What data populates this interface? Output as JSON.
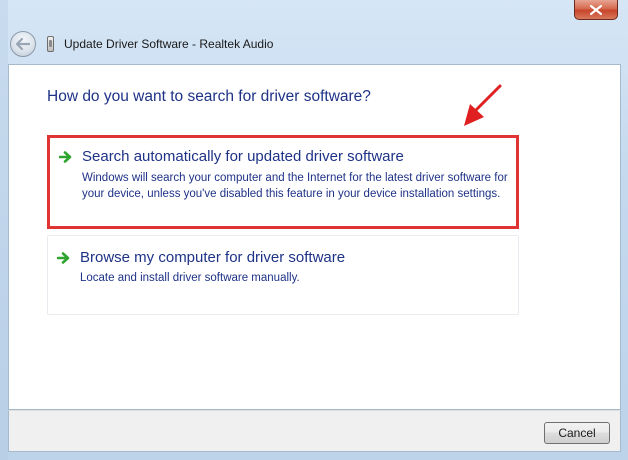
{
  "window": {
    "title": "Update Driver Software - Realtek Audio",
    "close_icon": "close-icon",
    "back_icon": "back-arrow-icon",
    "device_icon": "audio-device-icon"
  },
  "main": {
    "question": "How do you want to search for driver software?",
    "options": [
      {
        "title": "Search automatically for updated driver software",
        "description": "Windows will search your computer and the Internet for the latest driver software for your device, unless you've disabled this feature in your device installation settings.",
        "icon": "green-arrow-icon",
        "highlighted": true
      },
      {
        "title": "Browse my computer for driver software",
        "description": "Locate and install driver software manually.",
        "icon": "green-arrow-icon",
        "highlighted": false
      }
    ]
  },
  "footer": {
    "cancel_label": "Cancel"
  },
  "colors": {
    "link_blue": "#1e3287",
    "highlight_red": "#e03434",
    "arrow_green": "#2fa52f"
  }
}
